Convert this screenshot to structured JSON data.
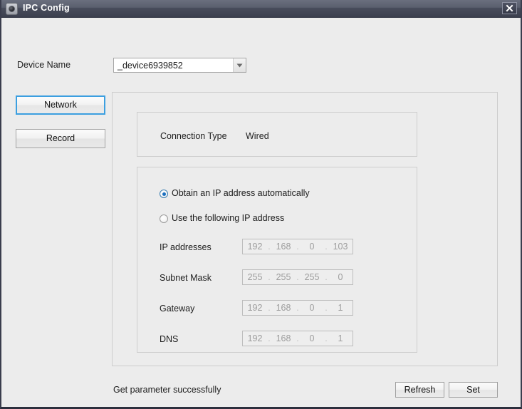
{
  "window": {
    "title": "IPC Config",
    "icon": "camera-icon",
    "close_icon": "close-icon"
  },
  "device": {
    "label": "Device Name",
    "value": "_device6939852",
    "placeholder": "_device6939852",
    "arrow_icon": "chevron-down-icon"
  },
  "nav": {
    "items": [
      {
        "label": "Network",
        "selected": true
      },
      {
        "label": "Record",
        "selected": false
      }
    ]
  },
  "connection": {
    "label": "Connection Type",
    "value": "Wired"
  },
  "ip_config": {
    "radios": [
      {
        "label": "Obtain an IP address automatically",
        "checked": true
      },
      {
        "label": "Use the following IP address",
        "checked": false
      }
    ],
    "fields": [
      {
        "label": "IP addresses",
        "octets": [
          "192",
          "168",
          "0",
          "103"
        ]
      },
      {
        "label": "Subnet Mask",
        "octets": [
          "255",
          "255",
          "255",
          "0"
        ]
      },
      {
        "label": "Gateway",
        "octets": [
          "192",
          "168",
          "0",
          "1"
        ]
      },
      {
        "label": "DNS",
        "octets": [
          "192",
          "168",
          "0",
          "1"
        ]
      }
    ],
    "separator": "."
  },
  "footer": {
    "status": "Get parameter successfully",
    "refresh_label": "Refresh",
    "set_label": "Set"
  },
  "colors": {
    "titlebar": "#4a4f5e",
    "accent_selected": "#3c9fe0",
    "radio_dot": "#1a6fbf",
    "client_bg": "#ececec",
    "disabled_text": "#9d9d9d"
  }
}
